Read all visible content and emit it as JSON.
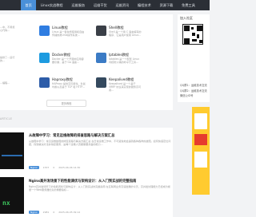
{
  "nav": {
    "items": [
      "首页",
      "Linux实战教程",
      "运维服务",
      "运维干货",
      "运维资讯",
      "编程技术",
      "资源下载",
      "免费工具"
    ]
  },
  "cards": [
    {
      "title": "Linux教程",
      "desc": "Linux 是一套免费使用和自由传播的类Unix操作系统...",
      "color": "#2f7de1",
      "icon": "linux-icon"
    },
    {
      "title": "Shell教程",
      "desc": "Shell 是一个用 C 语言编写的程序，它是用户使用 Linux...",
      "color": "#3a3f47",
      "icon": "shell-icon"
    },
    {
      "title": "Docker教程",
      "desc": "Docker 是一个开源的应用容器引擎，基于 Go 语言...",
      "color": "#1d9be0",
      "icon": "docker-icon"
    },
    {
      "title": "Iptables教程",
      "desc": "Iptables 是一个配置 Linux 内核防火墙的命令行工具...",
      "color": "#3b7bc5",
      "icon": "iptables-icon"
    },
    {
      "title": "Haproxy教程",
      "desc": "HAProxy 提供高可用性、负载均衡以及基于 TCP 和 HTTP...",
      "color": "#2d5ca8",
      "icon": "haproxy-icon"
    },
    {
      "title": "Keepalived教程",
      "desc": "Keepalived 是一个基于 VRRP 协议来实现的服务高可用...",
      "color": "#34495e",
      "icon": "keepalived-icon"
    }
  ],
  "left_desc": [
    "...中，不用担心代码...",
    "提供了...运行的...",
    "...编程..."
  ],
  "more_label": "更多教程",
  "sidebar": {
    "follow_title": "加入社区",
    "lines": [
      "QQ群1：运维技术交流",
      "QQ群2：运维技术交流",
      "微信公众号"
    ]
  },
  "section_label": "ARTICLE",
  "articles": [
    {
      "title": "从故障中学习：常见运维故障的排查思路与解决方案汇总",
      "desc": "从故障中学习：常见运维故障的排查思路与解决方案汇总 在日常运维工作中，不可避免地会遇到各种各样的故障。如何快速定位问题、找到解决方法并恢复服务，是每个运维人员都需要具备的能力...",
      "tag": "Nginx",
      "views": "1537",
      "likes": "0",
      "time": "2025-06-06 14:30"
    },
    {
      "title": "Nginx高并发场景下的性能调优与架构设计：从入门到实战的完整指南",
      "desc": "Nginx高并发场景下的性能调优与架构设计：从入门到实战的完整指南 在互联网业务高速发展的今天，高并发处理能力已经成为衡量一个Web服务器优劣的重要指标...",
      "tag": "Nginx",
      "views": "2981",
      "likes": "0",
      "time": "2025-06-05 09:12"
    }
  ]
}
